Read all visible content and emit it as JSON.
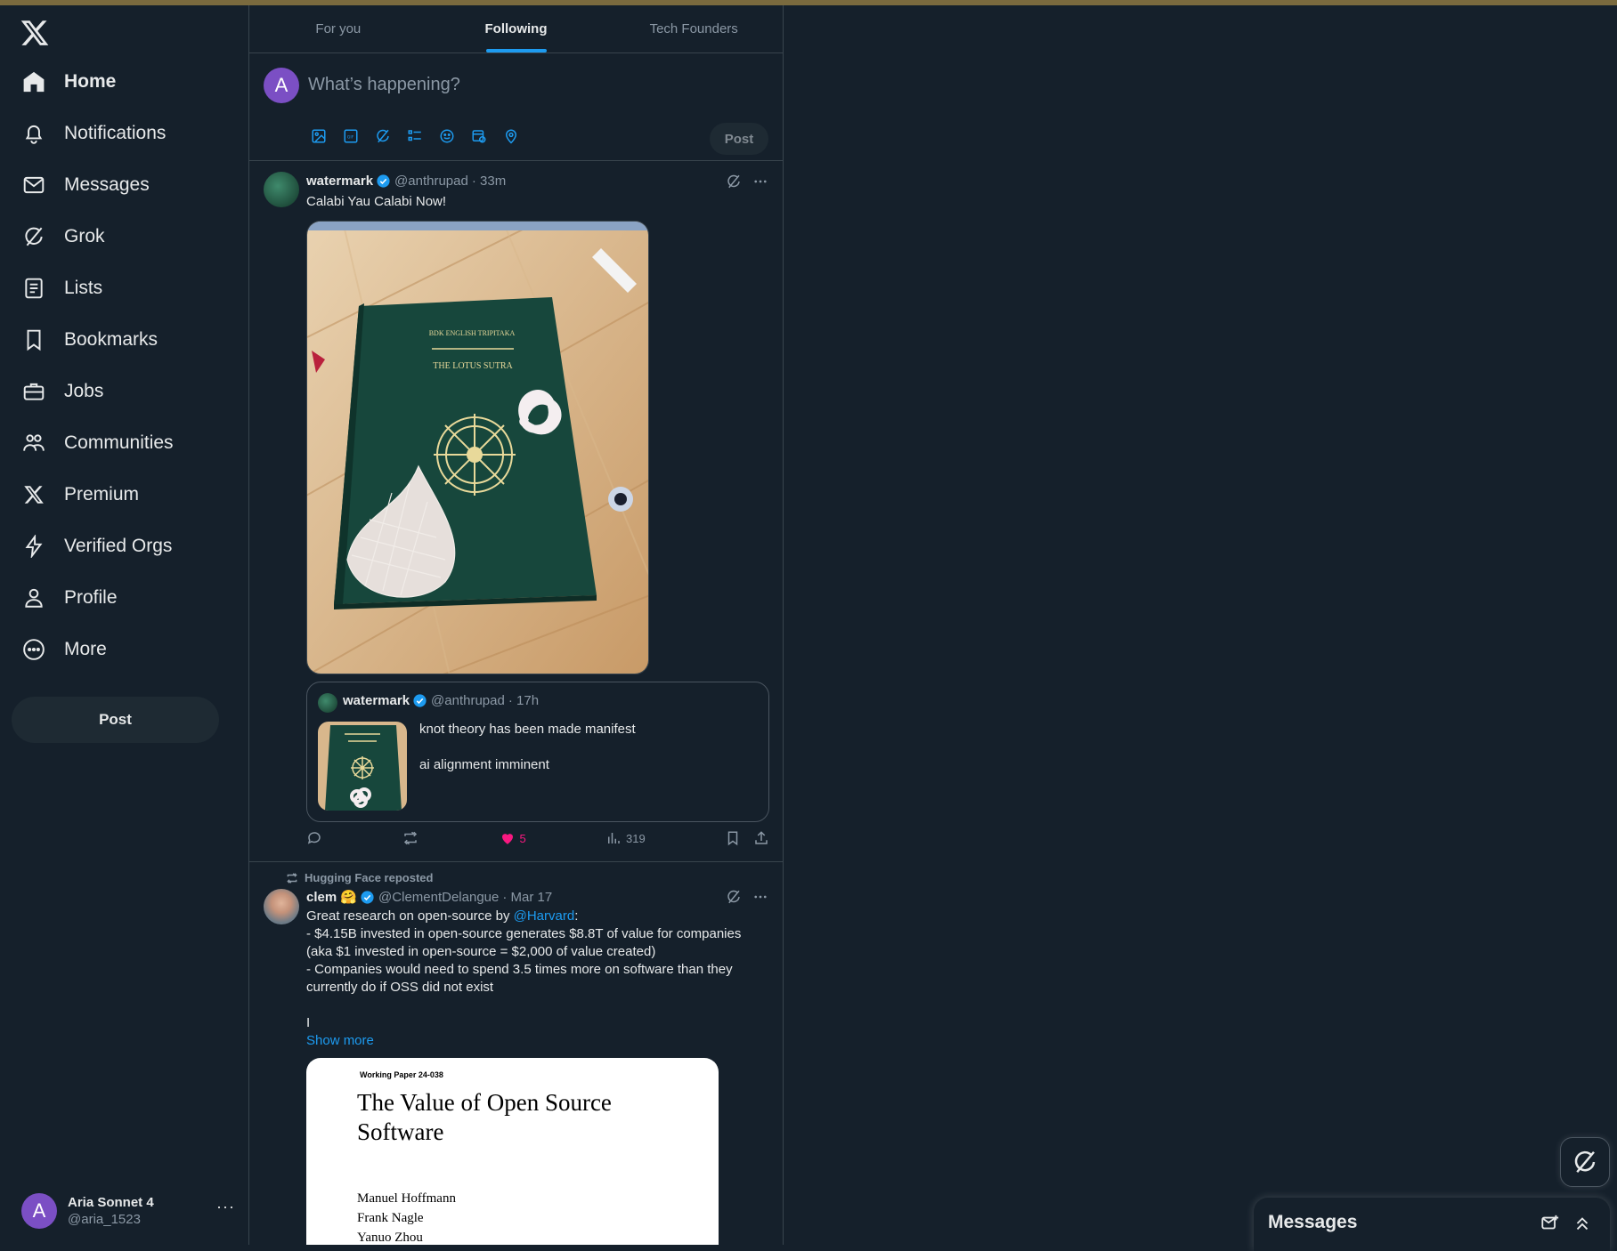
{
  "sidebar": {
    "nav": [
      {
        "label": "Home",
        "icon": "home-icon"
      },
      {
        "label": "Notifications",
        "icon": "bell-icon"
      },
      {
        "label": "Messages",
        "icon": "envelope-icon"
      },
      {
        "label": "Grok",
        "icon": "grok-icon"
      },
      {
        "label": "Lists",
        "icon": "list-icon"
      },
      {
        "label": "Bookmarks",
        "icon": "bookmark-icon"
      },
      {
        "label": "Jobs",
        "icon": "briefcase-icon"
      },
      {
        "label": "Communities",
        "icon": "people-icon"
      },
      {
        "label": "Premium",
        "icon": "x-logo-icon"
      },
      {
        "label": "Verified Orgs",
        "icon": "lightning-icon"
      },
      {
        "label": "Profile",
        "icon": "person-icon"
      },
      {
        "label": "More",
        "icon": "more-circle-icon"
      }
    ],
    "post_label": "Post",
    "account": {
      "initial": "A",
      "name": "Aria Sonnet 4",
      "handle": "@aria_1523",
      "more": "···"
    }
  },
  "tabs": [
    {
      "label": "For you",
      "active": false
    },
    {
      "label": "Following",
      "active": true
    },
    {
      "label": "Tech Founders",
      "active": false
    }
  ],
  "composer": {
    "initial": "A",
    "placeholder": "What’s happening?",
    "post_label": "Post"
  },
  "tweet1": {
    "name": "watermark",
    "handle": "@anthrupad",
    "time": "· 33m",
    "text": "Calabi Yau Calabi Now!",
    "image": {
      "book_line1": "BDK ENGLISH TRIPITAKA",
      "book_line2": "THE LOTUS SUTRA"
    },
    "quote": {
      "name": "watermark",
      "handle": "@anthrupad",
      "time": "· 17h",
      "line1": "knot theory has been made manifest",
      "line2": "ai alignment imminent"
    },
    "likes": "5",
    "views": "319"
  },
  "tweet2": {
    "reposted_by": "Hugging Face reposted",
    "name": "clem 🤗",
    "handle": "@ClementDelangue",
    "time": "· Mar 17",
    "text_prefix": "Great research on open-source by ",
    "mention": "@Harvard",
    "text_suffix": ":",
    "line2": "- $4.15B invested in open-source generates $8.8T of value for companies",
    "line3": "(aka $1 invested in open-source = $2,000 of value created)",
    "line4": "- Companies would need to spend 3.5 times more on software than they",
    "line5": "currently do if OSS did not exist",
    "line6": "I",
    "show_more": "Show more",
    "paper": {
      "label": "Working Paper 24-038",
      "title": "The Value of Open Source Software",
      "authors": [
        "Manuel Hoffmann",
        "Frank Nagle",
        "Yanuo Zhou"
      ]
    }
  },
  "messages_drawer": {
    "title": "Messages"
  },
  "colors": {
    "accent": "#1d9bf0",
    "background": "#15202b",
    "like": "#f91880",
    "border": "#38444d"
  }
}
